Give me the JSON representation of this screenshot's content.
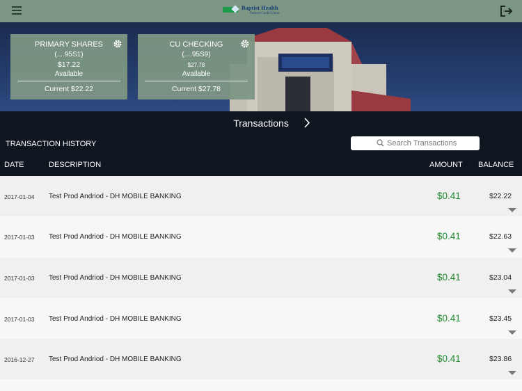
{
  "header": {
    "brand_name": "Baptist Health",
    "brand_sub": "Federal Credit Union",
    "menu_icon": "hamburger-menu-icon",
    "logout_icon": "logout-icon"
  },
  "accounts": [
    {
      "name": "PRIMARY SHARES",
      "number": "(....95S1)",
      "amount": "$17.22",
      "available_label": "Available",
      "current": "Current $22.22"
    },
    {
      "name": "CU CHECKING",
      "number": "(....95S9)",
      "amount": "$27.78",
      "available_label": "Available",
      "current": "Current $27.78"
    }
  ],
  "transactions_nav": {
    "label": "Transactions"
  },
  "history": {
    "title": "TRANSACTION HISTORY",
    "search": {
      "placeholder": "Search Transactions",
      "value": ""
    },
    "columns": {
      "date": "DATE",
      "description": "DESCRIPTION",
      "amount": "AMOUNT",
      "balance": "BALANCE"
    },
    "rows": [
      {
        "date": "2017-01-04",
        "description": "Test Prod Andriod - DH MOBILE BANKING",
        "amount": "$0.41",
        "balance": "$22.22"
      },
      {
        "date": "2017-01-03",
        "description": "Test Prod Andriod - DH MOBILE BANKING",
        "amount": "$0.41",
        "balance": "$22.63"
      },
      {
        "date": "2017-01-03",
        "description": "Test Prod Andriod - DH MOBILE BANKING",
        "amount": "$0.41",
        "balance": "$23.04"
      },
      {
        "date": "2017-01-03",
        "description": "Test Prod Andriod - DH MOBILE BANKING",
        "amount": "$0.41",
        "balance": "$23.45"
      },
      {
        "date": "2016-12-27",
        "description": "Test Prod Andriod - DH MOBILE BANKING",
        "amount": "$0.41",
        "balance": "$23.86"
      }
    ]
  },
  "colors": {
    "header": "#7b9783",
    "card": "#7c9683",
    "background": "#0f1620",
    "amount_green": "#1e8a2e"
  }
}
